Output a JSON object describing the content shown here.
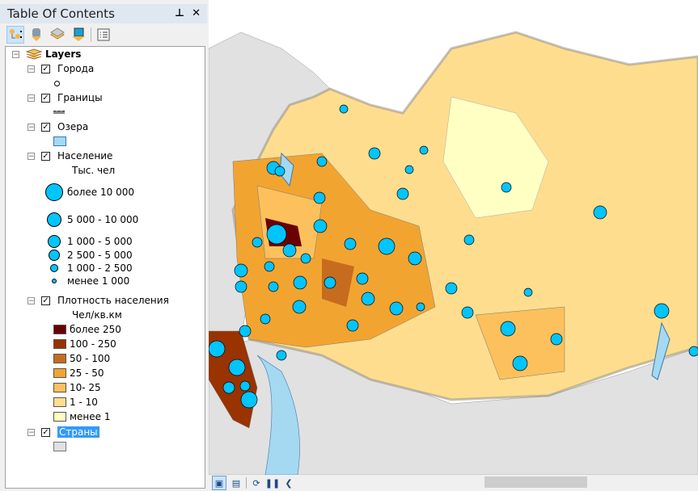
{
  "toc": {
    "title": "Table Of Contents",
    "pin": "⊥",
    "close": "✕",
    "toolbar": [
      {
        "name": "list-by-drawing-order-icon",
        "sel": true
      },
      {
        "name": "list-by-source-icon"
      },
      {
        "name": "list-by-visibility-icon"
      },
      {
        "name": "list-by-selection-icon"
      },
      {
        "name": "options-icon"
      }
    ],
    "root": "Layers",
    "layers": [
      {
        "name": "Города",
        "checked": true
      },
      {
        "name": "Границы",
        "checked": true
      },
      {
        "name": "Озера",
        "checked": true,
        "color": "#a5d9f2"
      },
      {
        "name": "Население",
        "checked": true,
        "heading": "Тыс. чел",
        "classes": [
          "более 10 000",
          "5 000 - 10 000",
          "1 000 - 5 000",
          "2 500 - 5 000",
          "1 000 - 2 500",
          "менее 1 000"
        ],
        "color": "#00c5ff"
      },
      {
        "name": "Плотность населения",
        "checked": true,
        "heading": "Чел/кв.км",
        "classes": [
          {
            "label": "более 250",
            "color": "#6b0000"
          },
          {
            "label": "100 - 250",
            "color": "#993300"
          },
          {
            "label": "50 - 100",
            "color": "#c76c1e"
          },
          {
            "label": "25 - 50",
            "color": "#f2a431"
          },
          {
            "label": "10- 25",
            "color": "#fcc15c"
          },
          {
            "label": "1 - 10",
            "color": "#ffdd8e"
          },
          {
            "label": "менее 1",
            "color": "#ffffc4"
          }
        ]
      },
      {
        "name": "Страны",
        "checked": true,
        "selected": true,
        "color": "#e1e1e1"
      }
    ]
  },
  "mapbar": {
    "layout_view": "layout-view-icon",
    "data_view": "data-view-icon",
    "refresh": "refresh-icon",
    "pause": "pause-icon",
    "back": "chevron-left-icon"
  }
}
